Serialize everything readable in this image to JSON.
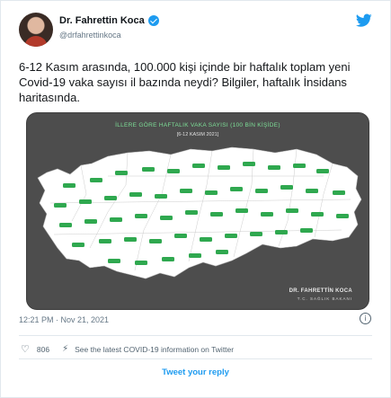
{
  "author": {
    "name": "Dr. Fahrettin Koca",
    "handle": "@drfahrettinkoca"
  },
  "tweet": {
    "text": "6-12 Kasım arasında, 100.000 kişi içinde bir haftalık toplam yeni Covid-19 vaka sayısı il bazında neydi? Bilgiler, haftalık İnsidans haritasında.",
    "timestamp": "12:21 PM · Nov 21, 2021"
  },
  "map": {
    "title": "İLLERE GÖRE HAFTALIK VAKA SAYISI (100 BİN KİŞİDE)",
    "subtitle": "[6-12 KASIM 2021]",
    "credit_name": "DR. FAHRETTİN KOCA",
    "credit_org": "T.C. SAĞLIK BAKANI",
    "colors": {
      "background": "#4d4d4d",
      "land": "#ffffff",
      "label": "#2fa84f"
    }
  },
  "actions": {
    "likes": "806",
    "covid_info": "See the latest COVID-19 information on Twitter",
    "reply": "Tweet your reply"
  },
  "icons": {
    "verified": "verified-badge-icon",
    "bird": "twitter-bird-icon",
    "info": "info-icon",
    "heart": "heart-icon",
    "bolt": "lightning-icon"
  }
}
